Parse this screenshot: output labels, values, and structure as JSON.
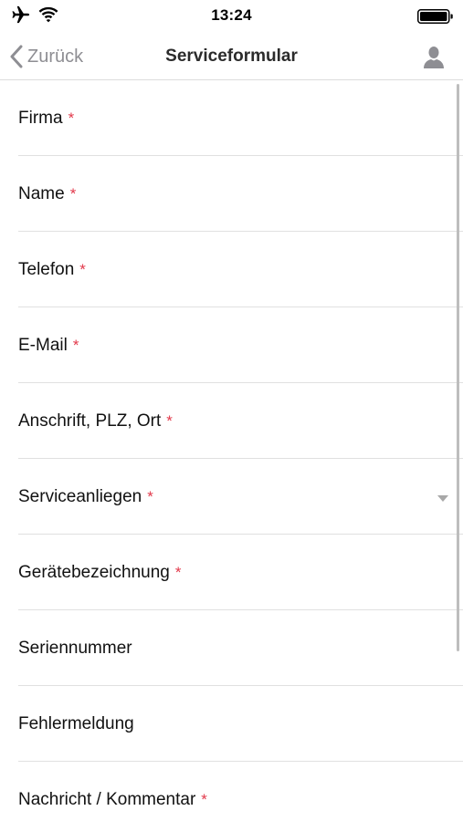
{
  "status_bar": {
    "time": "13:24",
    "icons": [
      "airplane-icon",
      "wifi-icon",
      "battery-icon"
    ]
  },
  "nav": {
    "back_label": "Zurück",
    "title": "Serviceformular",
    "back_icon": "chevron-left-icon",
    "profile_icon": "person-icon"
  },
  "form": {
    "required_marker": "*",
    "fields": [
      {
        "label": "Firma",
        "required": true,
        "type": "text"
      },
      {
        "label": "Name",
        "required": true,
        "type": "text"
      },
      {
        "label": "Telefon",
        "required": true,
        "type": "tel"
      },
      {
        "label": "E-Mail",
        "required": true,
        "type": "email"
      },
      {
        "label": "Anschrift, PLZ, Ort",
        "required": true,
        "type": "text"
      },
      {
        "label": "Serviceanliegen",
        "required": true,
        "type": "select"
      },
      {
        "label": "Gerätebezeichnung",
        "required": true,
        "type": "text"
      },
      {
        "label": "Seriennummer",
        "required": false,
        "type": "text"
      },
      {
        "label": "Fehlermeldung",
        "required": false,
        "type": "text"
      },
      {
        "label": "Nachricht / Kommentar",
        "required": true,
        "type": "textarea"
      }
    ]
  },
  "colors": {
    "required": "#e2394b",
    "nav_gray": "#8e8e93",
    "divider": "#e0e0e0"
  }
}
